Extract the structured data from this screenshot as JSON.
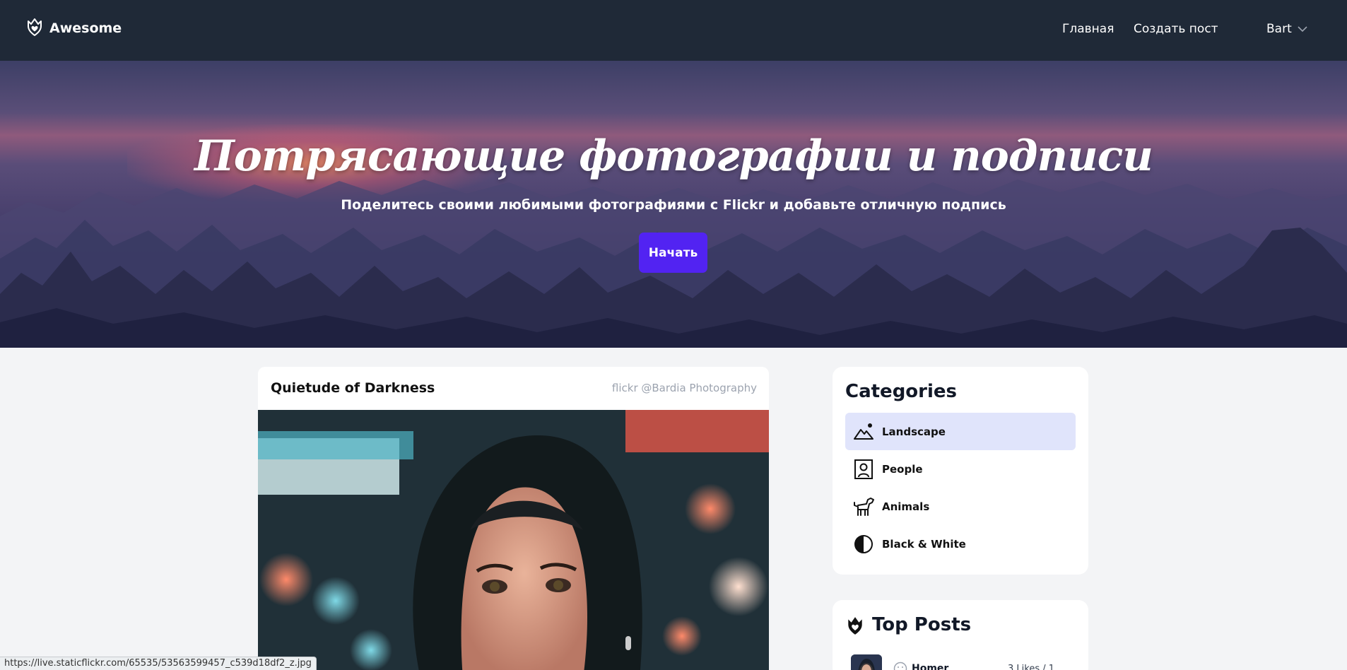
{
  "navbar": {
    "brand": "Awesome",
    "brand_icon": "heart-crown-icon",
    "links": {
      "home": "Главная",
      "create": "Создать пост"
    },
    "user": {
      "name": "Bart",
      "dropdown_icon": "chevron-down-icon"
    }
  },
  "hero": {
    "title": "Потрясающие фотографии и подписи",
    "subtitle": "Поделитесь своими любимыми фотографиями с Flickr и добавьте отличную подпись",
    "cta_label": "Начать",
    "cta_color": "#5223f2"
  },
  "post": {
    "title": "Quietude of Darkness",
    "credit": "flickr @Bardia Photography"
  },
  "categories": {
    "heading": "Categories",
    "items": [
      {
        "label": "Landscape",
        "icon": "mountain-icon",
        "active": true
      },
      {
        "label": "People",
        "icon": "portrait-icon",
        "active": false
      },
      {
        "label": "Animals",
        "icon": "dog-icon",
        "active": false
      },
      {
        "label": "Black & White",
        "icon": "contrast-icon",
        "active": false
      }
    ]
  },
  "top_posts": {
    "heading": "Top Posts",
    "icon": "heart-icon",
    "items": [
      {
        "author": "Homer",
        "likes": "3 Likes / 1"
      }
    ]
  },
  "status_bar": {
    "url": "https://live.staticflickr.com/65535/53563599457_c539d18df2_z.jpg"
  },
  "colors": {
    "navbar_bg": "#1f2937",
    "page_bg": "#f3f4f6",
    "active_category_bg": "#e0e4fb"
  }
}
